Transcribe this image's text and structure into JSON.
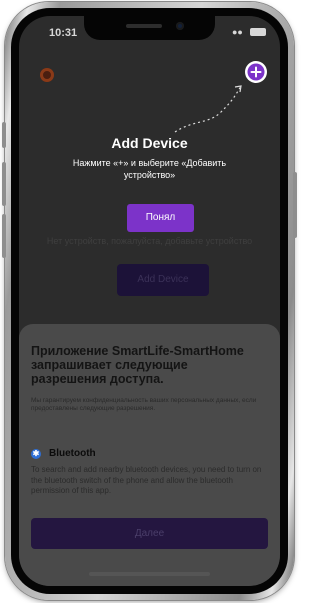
{
  "status_bar": {
    "time": "10:31",
    "wifi_icon": "wifi-icon",
    "battery_icon": "battery-icon"
  },
  "background": {
    "empty_text": "Нет устройств, пожалуйста, добавьте устройство",
    "add_device_button": "Add Device"
  },
  "hint": {
    "title": "Add Device",
    "text": "Нажмите «+» и выберите «Добавить устройство»",
    "got_it_button": "Понял",
    "plus_icon": "plus-icon",
    "accent_color": "#7c33c9"
  },
  "permission_sheet": {
    "title": "Приложение SmartLife-SmartHome запрашивает следующие разрешения доступа.",
    "note": "Мы гарантируем конфиденциальность ваших персональных данных, если предоставлены следующие разрешения.",
    "bluetooth": {
      "icon": "bluetooth-icon",
      "label": "Bluetooth",
      "description": "To search and add nearby bluetooth devices, you need to turn on the bluetooth switch of the phone and allow the bluetooth permission of this app."
    },
    "next_button": "Далее"
  }
}
